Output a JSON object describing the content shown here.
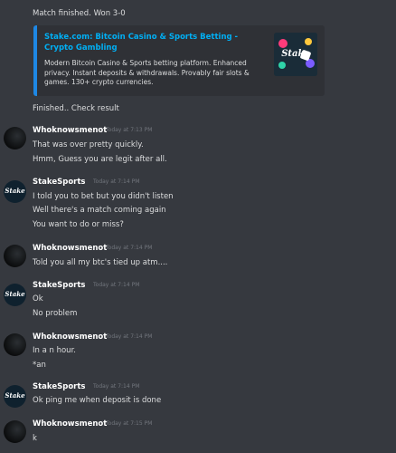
{
  "top_message": "Match finished. Won 3-0",
  "embed": {
    "title": "Stake.com: Bitcoin Casino & Sports Betting - Crypto Gambling",
    "description": "Modern Bitcoin Casino & Sports betting platform. Enhanced privacy. Instant deposits & withdrawals. Provably fair slots & games. 130+ crypto currencies.",
    "thumbnail_text": "Stake",
    "accent_color": "#1e88e5"
  },
  "finished_message": "Finished.. Check result",
  "avatar_stake_text": "Stake",
  "groups": [
    {
      "username": "Whoknowsmenot",
      "timestamp": "Today at 7:13 PM",
      "messages": [
        "That was over pretty quickly.",
        "Hmm, Guess you are legit after all."
      ]
    },
    {
      "username": "StakeSports",
      "timestamp": "Today at 7:14 PM",
      "messages": [
        "I told you to bet but you didn't listen",
        "Well there's a match coming again",
        "You want to do or miss?"
      ]
    },
    {
      "username": "Whoknowsmenot",
      "timestamp": "Today at 7:14 PM",
      "messages": [
        "Told you all my btc's tied up atm...."
      ]
    },
    {
      "username": "StakeSports",
      "timestamp": "Today at 7:14 PM",
      "messages": [
        "Ok",
        "No problem"
      ]
    },
    {
      "username": "Whoknowsmenot",
      "timestamp": "Today at 7:14 PM",
      "messages": [
        "In a n hour.",
        "*an"
      ]
    },
    {
      "username": "StakeSports",
      "timestamp": "Today at 7:14 PM",
      "messages": [
        "Ok ping me when deposit is done"
      ]
    },
    {
      "username": "Whoknowsmenot",
      "timestamp": "Today at 7:15 PM",
      "messages": [
        "k"
      ]
    }
  ]
}
